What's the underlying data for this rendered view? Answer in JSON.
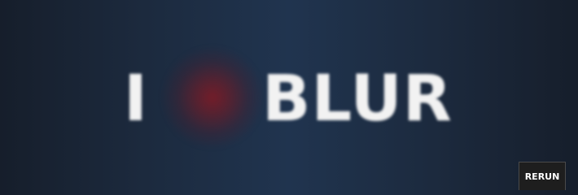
{
  "headline": {
    "first_word": "I",
    "heart_icon": "blurred-heart-icon",
    "last_word": "BLUR"
  },
  "controls": {
    "rerun_label": "RERUN"
  },
  "colors": {
    "text": "#f2f2f2",
    "heart": "#781c28",
    "background_center": "#20344f",
    "background_edge": "#161e2b",
    "button_bg": "#1e1e1e"
  }
}
